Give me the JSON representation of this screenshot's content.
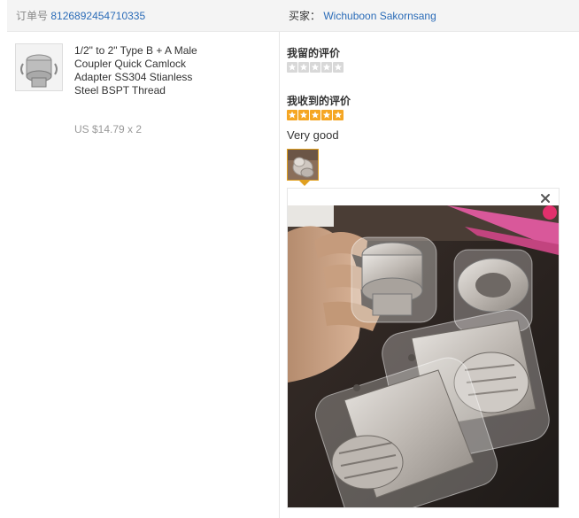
{
  "order": {
    "number_label": "订单号",
    "number_value": "8126892454710335",
    "buyer_label": "买家：",
    "buyer_name": "Wichuboon Sakornsang"
  },
  "product": {
    "title": "1/2\" to 2\" Type B + A Male Coupler Quick Camlock Adapter SS304 Stianless Steel BSPT Thread",
    "price": "US $14.79 x 2"
  },
  "my_review": {
    "label": "我留的评价",
    "rating": 0,
    "max": 5
  },
  "received_review": {
    "label": "我收到的评价",
    "rating": 5,
    "max": 5,
    "text": "Very good"
  },
  "colors": {
    "link": "#2b6cb8",
    "star_filled": "#f5a623",
    "star_empty": "#d8d8d8",
    "thumb_border": "#e0a020"
  },
  "icons": {
    "close": "close-icon",
    "star": "star-icon"
  }
}
